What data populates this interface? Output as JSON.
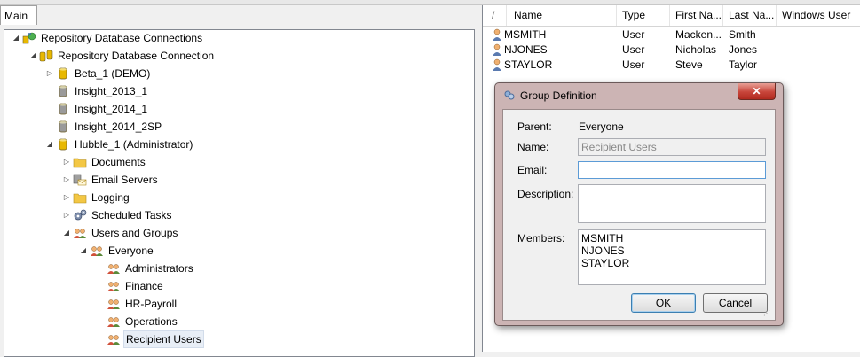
{
  "tabs": {
    "main": "Main"
  },
  "tree": [
    {
      "label": "Repository Database Connections",
      "icon": "connections-icon",
      "level": 0,
      "exp": "expanded"
    },
    {
      "label": "Repository Database Connection",
      "icon": "database-connection-icon",
      "level": 1,
      "exp": "expanded"
    },
    {
      "label": "Beta_1 (DEMO)",
      "icon": "database-yellow-icon",
      "level": 2,
      "exp": "collapsed"
    },
    {
      "label": "Insight_2013_1",
      "icon": "database-gray-icon",
      "level": 2,
      "exp": "none"
    },
    {
      "label": "Insight_2014_1",
      "icon": "database-gray-icon",
      "level": 2,
      "exp": "none"
    },
    {
      "label": "Insight_2014_2SP",
      "icon": "database-gray-icon",
      "level": 2,
      "exp": "none"
    },
    {
      "label": "Hubble_1 (Administrator)",
      "icon": "database-yellow-icon",
      "level": 2,
      "exp": "expanded"
    },
    {
      "label": "Documents",
      "icon": "folder-icon",
      "level": 3,
      "exp": "collapsed"
    },
    {
      "label": "Email Servers",
      "icon": "email-server-icon",
      "level": 3,
      "exp": "collapsed"
    },
    {
      "label": "Logging",
      "icon": "folder-icon",
      "level": 3,
      "exp": "collapsed"
    },
    {
      "label": "Scheduled Tasks",
      "icon": "gears-icon",
      "level": 3,
      "exp": "collapsed"
    },
    {
      "label": "Users and Groups",
      "icon": "users-icon",
      "level": 3,
      "exp": "expanded"
    },
    {
      "label": "Everyone",
      "icon": "group-icon",
      "level": 4,
      "exp": "expanded"
    },
    {
      "label": "Administrators",
      "icon": "group-icon",
      "level": 5,
      "exp": "none"
    },
    {
      "label": "Finance",
      "icon": "group-icon",
      "level": 5,
      "exp": "none"
    },
    {
      "label": "HR-Payroll",
      "icon": "group-icon",
      "level": 5,
      "exp": "none"
    },
    {
      "label": "Operations",
      "icon": "group-icon",
      "level": 5,
      "exp": "none"
    },
    {
      "label": "Recipient Users",
      "icon": "group-icon",
      "level": 5,
      "exp": "none",
      "selected": true
    }
  ],
  "list": {
    "columns": [
      "/",
      "Name",
      "Type",
      "First Na...",
      "Last Na...",
      "Windows User"
    ],
    "rows": [
      {
        "name": "MSMITH",
        "type": "User",
        "first": "Macken...",
        "last": "Smith"
      },
      {
        "name": "NJONES",
        "type": "User",
        "first": "Nicholas",
        "last": "Jones"
      },
      {
        "name": "STAYLOR",
        "type": "User",
        "first": "Steve",
        "last": "Taylor"
      }
    ]
  },
  "dialog": {
    "title": "Group Definition",
    "close": "✕",
    "parent_label": "Parent:",
    "parent_value": "Everyone",
    "name_label": "Name:",
    "name_value": "Recipient Users",
    "email_label": "Email:",
    "email_value": "",
    "description_label": "Description:",
    "description_value": "",
    "members_label": "Members:",
    "members": [
      "MSMITH",
      "NJONES",
      "STAYLOR"
    ],
    "ok": "OK",
    "cancel": "Cancel"
  },
  "colors": {
    "yellow_db": "#e8b800",
    "gray_db": "#9a9a9a",
    "selection": "#e8eef6"
  }
}
